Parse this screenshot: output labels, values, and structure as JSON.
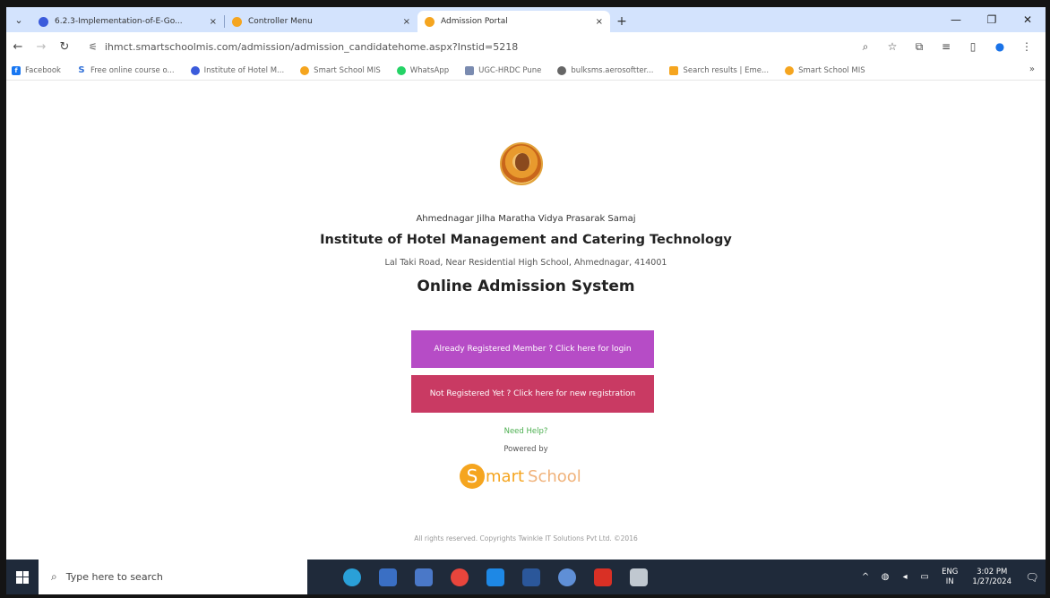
{
  "browser": {
    "tabs": [
      {
        "title": "6.2.3-Implementation-of-E-Go...",
        "favicon_color": "#3b5bdb",
        "active": false
      },
      {
        "title": "Controller Menu",
        "favicon_color": "#f5a51f",
        "active": false
      },
      {
        "title": "Admission Portal",
        "favicon_color": "#f5a51f",
        "active": true
      }
    ],
    "new_tab_symbol": "+",
    "close_symbol": "×",
    "url": "ihmct.smartschoolmis.com/admission/admission_candidatehome.aspx?Instid=5218",
    "bookmarks": [
      {
        "label": "Facebook",
        "color": "#1877f2",
        "glyph": "f"
      },
      {
        "label": "Free online course o...",
        "color": "#2f6fd8",
        "glyph": "S"
      },
      {
        "label": "Institute of Hotel M...",
        "color": "#3b5bdb",
        "glyph": ""
      },
      {
        "label": "Smart School MIS",
        "color": "#f5a51f",
        "glyph": ""
      },
      {
        "label": "WhatsApp",
        "color": "#25d366",
        "glyph": ""
      },
      {
        "label": "UGC-HRDC Pune",
        "color": "#7a8bb0",
        "glyph": ""
      },
      {
        "label": "bulksms.aerosoftter...",
        "color": "#666666",
        "glyph": ""
      },
      {
        "label": "Search results | Eme...",
        "color": "#f5a51f",
        "glyph": ""
      },
      {
        "label": "Smart School MIS",
        "color": "#f5a51f",
        "glyph": ""
      }
    ],
    "bookmarks_more": "»"
  },
  "page": {
    "org_name": "Ahmednagar Jilha Maratha Vidya Prasarak Samaj",
    "institute_name": "Institute of Hotel Management and Catering Technology",
    "address": "Lal Taki Road, Near Residential High School, Ahmednagar, 414001",
    "system_title": "Online Admission System",
    "login_button": "Already Registered Member ? Click here for login",
    "register_button": "Not Registered Yet ? Click here for new registration",
    "help_link": "Need Help?",
    "powered_by": "Powered by",
    "brand_s": "S",
    "brand_mart": "mart",
    "brand_school": "School",
    "copyright": "All rights reserved. Copyrights Twinkle IT Solutions Pvt Ltd. ©2016"
  },
  "taskbar": {
    "search_placeholder": "Type here to search",
    "lang_top": "ENG",
    "lang_bottom": "IN",
    "time": "3:02 PM",
    "date": "1/27/2024",
    "app_colors": [
      "#2aa0d8",
      "#f0b400",
      "#2f6fd8",
      "#e8453c",
      "#1e88e5",
      "#2b579a",
      "#5f8fd6",
      "#d93025",
      "#c0c8d0"
    ]
  }
}
